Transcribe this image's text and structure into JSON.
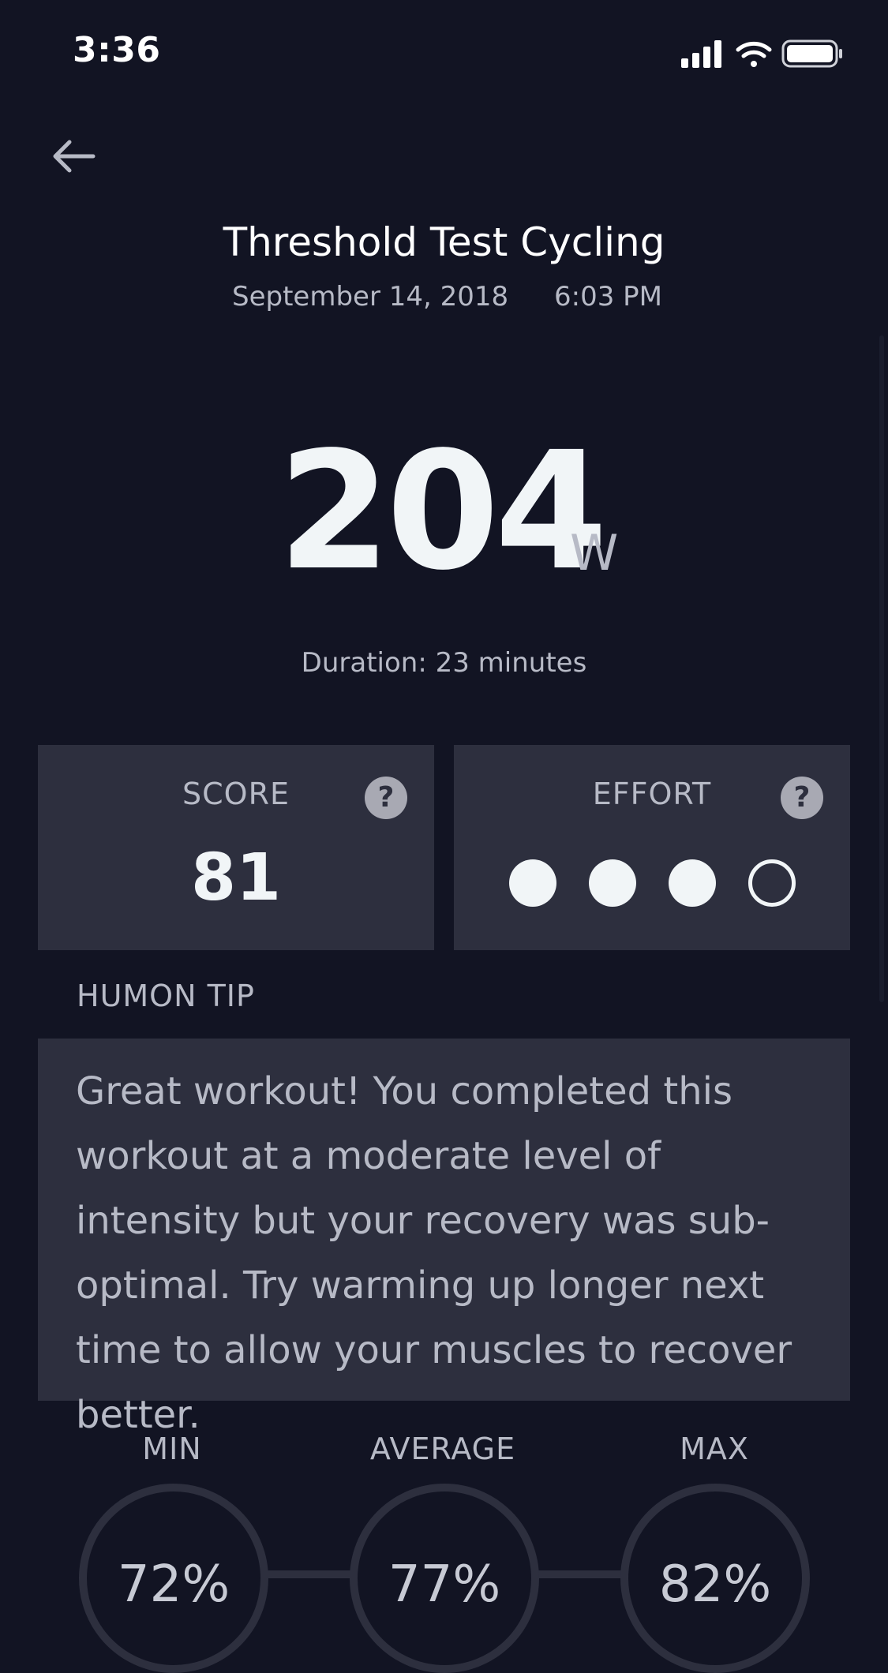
{
  "status_bar": {
    "time": "3:36"
  },
  "header": {
    "title": "Threshold Test Cycling",
    "date": "September 14, 2018",
    "time": "6:03 PM"
  },
  "metric": {
    "value": "204",
    "unit": "W",
    "duration": "Duration: 23 minutes"
  },
  "score": {
    "label": "SCORE",
    "value": "81",
    "help": "?"
  },
  "effort": {
    "label": "EFFORT",
    "help": "?",
    "filled": 3,
    "total": 4
  },
  "tip": {
    "label": "HUMON TIP",
    "text": "Great workout! You completed this workout at a moderate level of intensity but your recovery was sub-optimal. Try warming up longer next time to allow your muscles to recover better."
  },
  "stats": {
    "min": {
      "label": "MIN",
      "value": "72%"
    },
    "average": {
      "label": "AVERAGE",
      "value": "77%"
    },
    "max": {
      "label": "MAX",
      "value": "82%"
    }
  },
  "colors": {
    "background": "#121423",
    "card": "#2d2f3e",
    "primary_text": "#f1f5f7",
    "secondary_text": "#b7bac6"
  },
  "icons": {
    "back": "arrow-left-icon",
    "signal": "cellular-signal-icon",
    "wifi": "wifi-icon",
    "battery": "battery-icon",
    "help": "question-mark-icon"
  }
}
